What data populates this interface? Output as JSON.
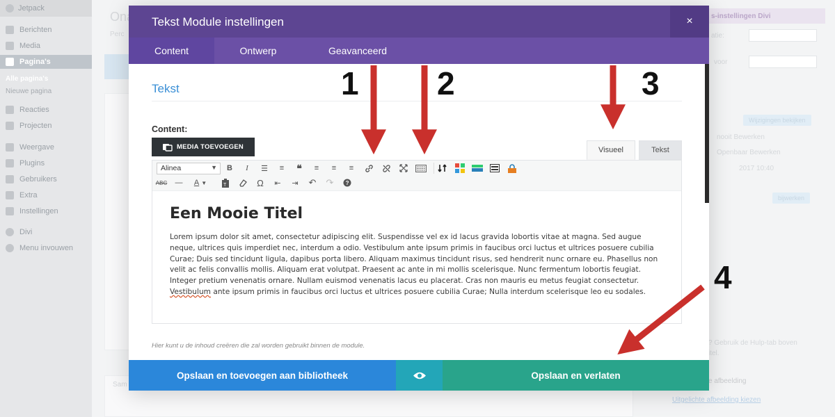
{
  "wp_sidebar": {
    "top_label": "Jetpack",
    "items": [
      "Berichten",
      "Media",
      "Pagina's",
      "Reacties",
      "Projecten",
      "Weergave",
      "Plugins",
      "Gebruikers",
      "Extra",
      "Instellingen",
      "Divi",
      "Menu invouwen"
    ],
    "sub_items": [
      "Alle pagina's",
      "Nieuwe pagina"
    ]
  },
  "background": {
    "page_title": "Ona",
    "page_sub": "Perc",
    "side_panel_title": "s-instellingen Divi",
    "side_panel_rows": [
      "atie:",
      "voor",
      "Wijzigingen bekijken",
      "nooit Bewerken",
      "Openbaar Bewerken",
      "2017 10:40",
      "bijwerken",
      "?  Gebruik de Hulp-tab boven",
      "itel.",
      "e afbeelding",
      "Uitgelichte afbeelding kiezen"
    ],
    "bottom_label": "Sam"
  },
  "modal": {
    "title": "Tekst Module instellingen",
    "close_glyph": "×",
    "tabs": [
      "Content",
      "Ontwerp",
      "Geavanceerd"
    ],
    "section_title": "Tekst",
    "content_label": "Content:",
    "media_button": "MEDIA TOEVOEGEN",
    "editor_tabs": {
      "visual": "Visueel",
      "text": "Tekst"
    },
    "format_select": "Alinea",
    "editor": {
      "heading": "Een Mooie Titel",
      "para_before": "Lorem ipsum dolor sit amet, consectetur adipiscing elit. Suspendisse vel ex id lacus gravida lobortis vitae at magna. Sed augue neque, ultrices quis imperdiet nec, interdum a odio. Vestibulum ante ipsum primis in faucibus orci luctus et ultrices posuere cubilia Curae; Duis sed tincidunt ligula, dapibus porta libero. Aliquam maximus tincidunt risus, sed hendrerit nunc ornare eu. Phasellus non velit ac felis convallis mollis. Aliquam erat volutpat. Praesent ac ante in mi mollis scelerisque. Nunc fermentum lobortis feugiat. Integer pretium venenatis ornare. Nullam euismod venenatis lacus eu placerat. Cras non mauris eu metus feugiat consectetur. ",
      "para_spell": "Vestibulum",
      "para_after": " ante ipsum primis in faucibus orci luctus et ultrices posuere cubilia Curae; Nulla interdum scelerisque leo eu sodales."
    },
    "help_text": "Hier kunt u de inhoud creëren die zal worden gebruikt binnen de module.",
    "footer": {
      "library_button": "Opslaan en toevoegen aan bibliotheek",
      "save_button": "Opslaan en verlaten"
    }
  },
  "annotations": {
    "labels": [
      "1",
      "2",
      "3",
      "4"
    ],
    "arrow_color": "#c9302c"
  },
  "colors": {
    "header_purple": "#5d4592",
    "tabs_purple": "#6b50a6",
    "link_blue": "#3a8fd6",
    "btn_blue": "#2b87da",
    "btn_teal": "#23a6b8",
    "btn_green": "#29a48b"
  }
}
